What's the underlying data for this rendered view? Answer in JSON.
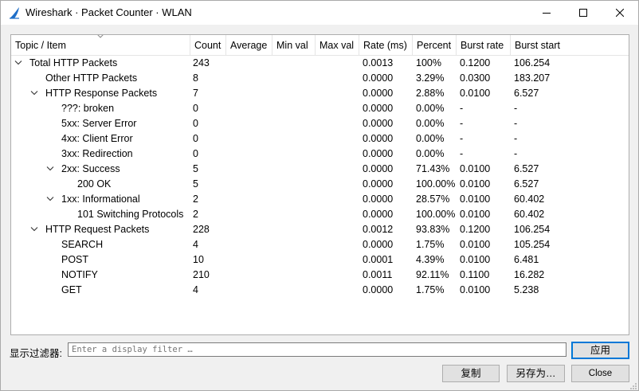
{
  "window": {
    "title": "Wireshark · Packet Counter · WLAN",
    "icon": "wireshark-fin-icon",
    "controls": {
      "minimize": "minimize-icon",
      "maximize": "maximize-icon",
      "close": "close-icon"
    }
  },
  "tree": {
    "columns": [
      "Topic / Item",
      "Count",
      "Average",
      "Min val",
      "Max val",
      "Rate (ms)",
      "Percent",
      "Burst rate",
      "Burst start"
    ],
    "rows": [
      {
        "level": 0,
        "expanded": true,
        "item": "Total HTTP Packets",
        "count": "243",
        "average": "",
        "min": "",
        "max": "",
        "rate": "0.0013",
        "percent": "100%",
        "burst_rate": "0.1200",
        "burst_start": "106.254"
      },
      {
        "level": 1,
        "expanded": null,
        "item": "Other HTTP Packets",
        "count": "8",
        "average": "",
        "min": "",
        "max": "",
        "rate": "0.0000",
        "percent": "3.29%",
        "burst_rate": "0.0300",
        "burst_start": "183.207"
      },
      {
        "level": 1,
        "expanded": true,
        "item": "HTTP Response Packets",
        "count": "7",
        "average": "",
        "min": "",
        "max": "",
        "rate": "0.0000",
        "percent": "2.88%",
        "burst_rate": "0.0100",
        "burst_start": "6.527"
      },
      {
        "level": 2,
        "expanded": null,
        "item": "???: broken",
        "count": "0",
        "average": "",
        "min": "",
        "max": "",
        "rate": "0.0000",
        "percent": "0.00%",
        "burst_rate": "-",
        "burst_start": "-"
      },
      {
        "level": 2,
        "expanded": null,
        "item": "5xx: Server Error",
        "count": "0",
        "average": "",
        "min": "",
        "max": "",
        "rate": "0.0000",
        "percent": "0.00%",
        "burst_rate": "-",
        "burst_start": "-"
      },
      {
        "level": 2,
        "expanded": null,
        "item": "4xx: Client Error",
        "count": "0",
        "average": "",
        "min": "",
        "max": "",
        "rate": "0.0000",
        "percent": "0.00%",
        "burst_rate": "-",
        "burst_start": "-"
      },
      {
        "level": 2,
        "expanded": null,
        "item": "3xx: Redirection",
        "count": "0",
        "average": "",
        "min": "",
        "max": "",
        "rate": "0.0000",
        "percent": "0.00%",
        "burst_rate": "-",
        "burst_start": "-"
      },
      {
        "level": 2,
        "expanded": true,
        "item": "2xx: Success",
        "count": "5",
        "average": "",
        "min": "",
        "max": "",
        "rate": "0.0000",
        "percent": "71.43%",
        "burst_rate": "0.0100",
        "burst_start": "6.527"
      },
      {
        "level": 3,
        "expanded": null,
        "item": "200 OK",
        "count": "5",
        "average": "",
        "min": "",
        "max": "",
        "rate": "0.0000",
        "percent": "100.00%",
        "burst_rate": "0.0100",
        "burst_start": "6.527"
      },
      {
        "level": 2,
        "expanded": true,
        "item": "1xx: Informational",
        "count": "2",
        "average": "",
        "min": "",
        "max": "",
        "rate": "0.0000",
        "percent": "28.57%",
        "burst_rate": "0.0100",
        "burst_start": "60.402"
      },
      {
        "level": 3,
        "expanded": null,
        "item": "101 Switching Protocols",
        "count": "2",
        "average": "",
        "min": "",
        "max": "",
        "rate": "0.0000",
        "percent": "100.00%",
        "burst_rate": "0.0100",
        "burst_start": "60.402"
      },
      {
        "level": 1,
        "expanded": true,
        "item": "HTTP Request Packets",
        "count": "228",
        "average": "",
        "min": "",
        "max": "",
        "rate": "0.0012",
        "percent": "93.83%",
        "burst_rate": "0.1200",
        "burst_start": "106.254"
      },
      {
        "level": 2,
        "expanded": null,
        "item": "SEARCH",
        "count": "4",
        "average": "",
        "min": "",
        "max": "",
        "rate": "0.0000",
        "percent": "1.75%",
        "burst_rate": "0.0100",
        "burst_start": "105.254"
      },
      {
        "level": 2,
        "expanded": null,
        "item": "POST",
        "count": "10",
        "average": "",
        "min": "",
        "max": "",
        "rate": "0.0001",
        "percent": "4.39%",
        "burst_rate": "0.0100",
        "burst_start": "6.481"
      },
      {
        "level": 2,
        "expanded": null,
        "item": "NOTIFY",
        "count": "210",
        "average": "",
        "min": "",
        "max": "",
        "rate": "0.0011",
        "percent": "92.11%",
        "burst_rate": "0.1100",
        "burst_start": "16.282"
      },
      {
        "level": 2,
        "expanded": null,
        "item": "GET",
        "count": "4",
        "average": "",
        "min": "",
        "max": "",
        "rate": "0.0000",
        "percent": "1.75%",
        "burst_rate": "0.0100",
        "burst_start": "5.238"
      }
    ]
  },
  "filter": {
    "label": "显示过滤器:",
    "placeholder": "Enter a display filter …",
    "value": ""
  },
  "buttons": {
    "apply": "应用",
    "copy": "复制",
    "save_as": "另存为…",
    "close": "Close"
  },
  "colors": {
    "accent": "#0078d7",
    "icon_blue": "#1e6ec8",
    "border": "#adadad"
  }
}
